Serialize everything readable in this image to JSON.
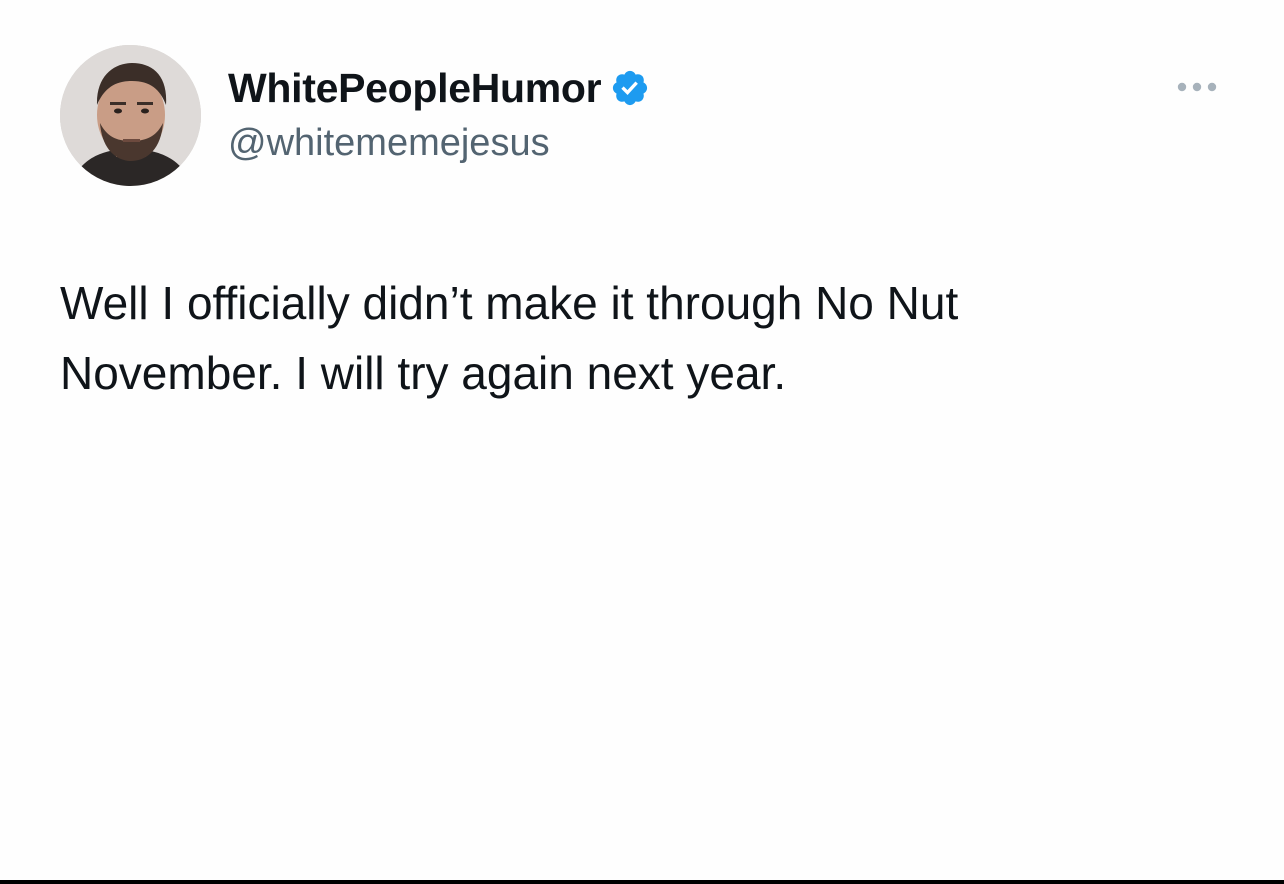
{
  "tweet": {
    "author": {
      "display_name": "WhitePeopleHumor",
      "handle": "@whitememejesus",
      "verified": true,
      "avatar_icon": "user-avatar-photo"
    },
    "more_icon": "more-options-icon",
    "text": "Well I officially didn’t make it through No Nut\nNovember. I will try again next year."
  },
  "colors": {
    "background": "#fefefe",
    "text_primary": "#0f1419",
    "text_secondary": "#536471",
    "verified_badge": "#1d9bf0",
    "more_icon": "#a7b2bb"
  }
}
